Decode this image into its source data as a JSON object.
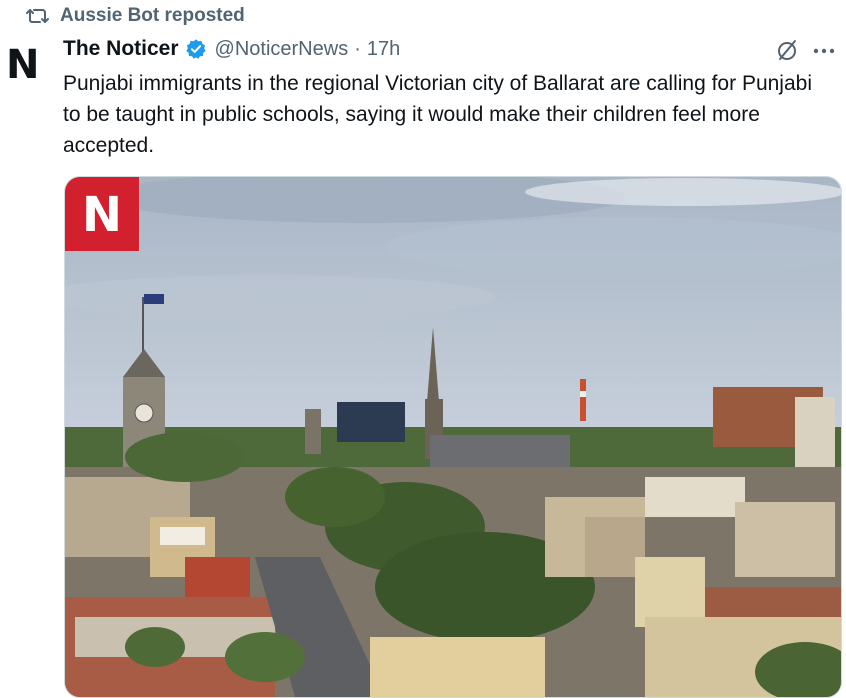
{
  "repost": {
    "icon": "repost-icon",
    "text": "Aussie Bot reposted"
  },
  "author": {
    "logo": "N",
    "name": "The Noticer",
    "verified": true,
    "handle": "@NoticerNews",
    "separator": "·",
    "time": "17h"
  },
  "actions": {
    "grok_icon": "slashed-circle-icon",
    "more_icon": "more-options-icon"
  },
  "text": "Punjabi immigrants in the regional Victorian city of Ballarat are calling for Punjabi to be taught in public schools, saying it would make their children feel more accepted.",
  "media": {
    "badge_letter": "N",
    "colors": {
      "badge": "#d2202f",
      "sky": "#c7d1de",
      "verified": "#1d9bf0"
    }
  }
}
